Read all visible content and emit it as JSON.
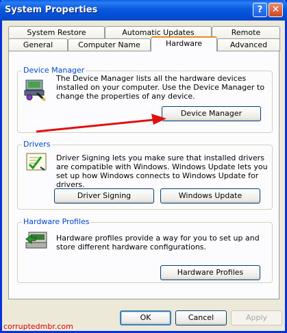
{
  "window": {
    "title": "System Properties"
  },
  "titlebar": {
    "help_glyph": "?",
    "close_glyph": "✕"
  },
  "tabs": {
    "row1": [
      "System Restore",
      "Automatic Updates",
      "Remote"
    ],
    "row2": [
      "General",
      "Computer Name",
      "Hardware",
      "Advanced"
    ],
    "active": "Hardware"
  },
  "device_manager": {
    "group_label": "Device Manager",
    "description": "The Device Manager lists all the hardware devices installed on your computer. Use the Device Manager to change the properties of any device.",
    "button": "Device Manager",
    "icon": "device-manager-icon"
  },
  "drivers": {
    "group_label": "Drivers",
    "description": "Driver Signing lets you make sure that installed drivers are compatible with Windows. Windows Update lets you set up how Windows connects to Windows Update for drivers.",
    "signing_button": "Driver Signing",
    "update_button": "Windows Update",
    "icon": "driver-signing-icon"
  },
  "hardware_profiles": {
    "group_label": "Hardware Profiles",
    "description": "Hardware profiles provide a way for you to set up and store different hardware configurations.",
    "button": "Hardware Profiles",
    "icon": "hardware-profiles-icon"
  },
  "footer": {
    "ok": "OK",
    "cancel": "Cancel",
    "apply": "Apply"
  },
  "watermark": "corruptedmbr.com",
  "colors": {
    "accent_tab": "#e68b2c",
    "group_label": "#0046d5",
    "arrow": "#e01010",
    "titlebar": "#0a58db"
  }
}
